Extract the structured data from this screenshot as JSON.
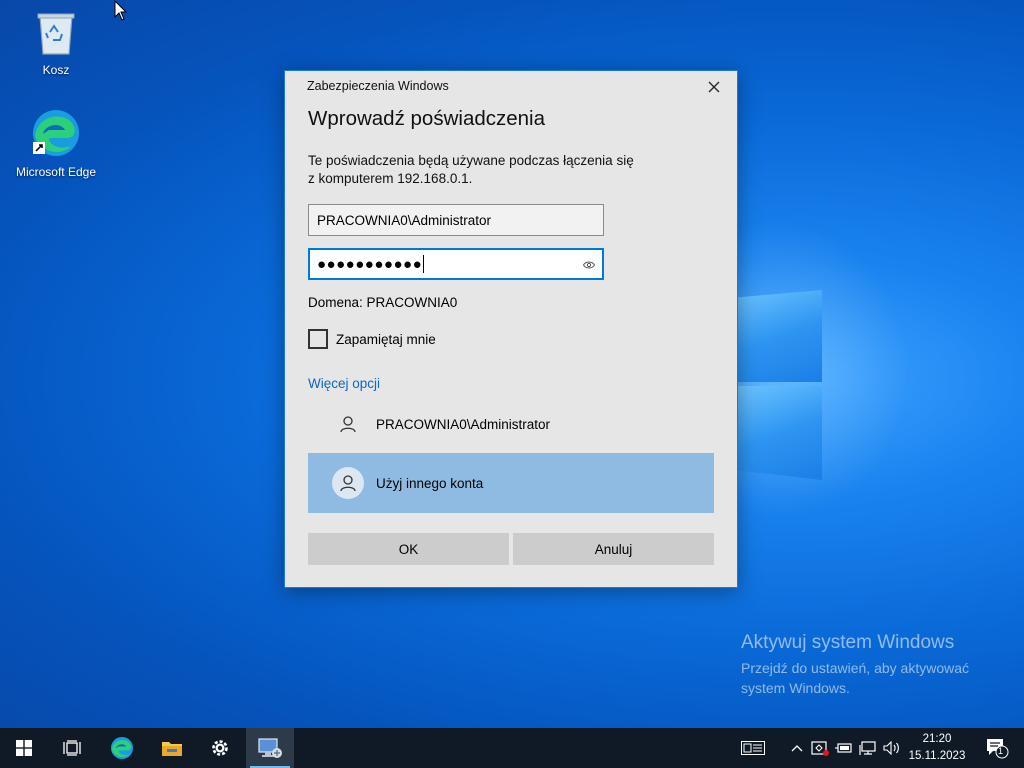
{
  "desktop": {
    "icons": [
      {
        "label": "Kosz",
        "icon": "recycle-bin-icon"
      },
      {
        "label": "Microsoft Edge",
        "icon": "edge-icon"
      }
    ],
    "activation": {
      "title": "Aktywuj system Windows",
      "subtitle": "Przejdź do ustawień, aby aktywować system Windows."
    }
  },
  "dialog": {
    "caption": "Zabezpieczenia Windows",
    "title": "Wprowadź poświadczenia",
    "description_line1": "Te poświadczenia będą używane podczas łączenia się",
    "description_line2": "z komputerem 192.168.0.1.",
    "username_value": "PRACOWNIA0\\Administrator",
    "password_masked": "●●●●●●●●●●●",
    "domain_text": "Domena: PRACOWNIA0",
    "remember_label": "Zapamiętaj mnie",
    "remember_checked": false,
    "more_options": "Więcej opcji",
    "accounts": [
      {
        "label": "PRACOWNIA0\\Administrator",
        "selected": false
      },
      {
        "label": "Użyj innego konta",
        "selected": true
      }
    ],
    "ok_label": "OK",
    "cancel_label": "Anuluj"
  },
  "taskbar": {
    "items": [
      "start-icon",
      "task-view-icon",
      "edge-icon",
      "file-explorer-icon",
      "settings-icon",
      "remote-desktop-icon"
    ],
    "active_item": "remote-desktop-icon",
    "clock_time": "21:20",
    "clock_date": "15.11.2023",
    "notification_count": "1"
  },
  "colors": {
    "accent": "#0078d7",
    "selected_account_bg": "#8fbbe3",
    "taskbar_bg": "#101a26"
  }
}
